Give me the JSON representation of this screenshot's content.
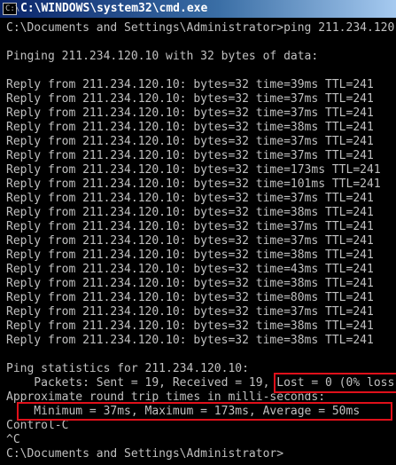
{
  "window": {
    "title": "C:\\WINDOWS\\system32\\cmd.exe",
    "icon_glyph": "C:\\",
    "icon_name": "console-icon",
    "colors": {
      "background": "#000000",
      "text": "#c0c0c0",
      "highlight_box": "#e0101a",
      "titlebar_start": "#0a246a",
      "titlebar_end": "#a6caf0"
    }
  },
  "console": {
    "lines": [
      "C:\\Documents and Settings\\Administrator>ping 211.234.120.10",
      "",
      "Pinging 211.234.120.10 with 32 bytes of data:",
      "",
      "Reply from 211.234.120.10: bytes=32 time=39ms TTL=241",
      "Reply from 211.234.120.10: bytes=32 time=37ms TTL=241",
      "Reply from 211.234.120.10: bytes=32 time=37ms TTL=241",
      "Reply from 211.234.120.10: bytes=32 time=38ms TTL=241",
      "Reply from 211.234.120.10: bytes=32 time=37ms TTL=241",
      "Reply from 211.234.120.10: bytes=32 time=37ms TTL=241",
      "Reply from 211.234.120.10: bytes=32 time=173ms TTL=241",
      "Reply from 211.234.120.10: bytes=32 time=101ms TTL=241",
      "Reply from 211.234.120.10: bytes=32 time=37ms TTL=241",
      "Reply from 211.234.120.10: bytes=32 time=38ms TTL=241",
      "Reply from 211.234.120.10: bytes=32 time=37ms TTL=241",
      "Reply from 211.234.120.10: bytes=32 time=37ms TTL=241",
      "Reply from 211.234.120.10: bytes=32 time=38ms TTL=241",
      "Reply from 211.234.120.10: bytes=32 time=43ms TTL=241",
      "Reply from 211.234.120.10: bytes=32 time=38ms TTL=241",
      "Reply from 211.234.120.10: bytes=32 time=80ms TTL=241",
      "Reply from 211.234.120.10: bytes=32 time=37ms TTL=241",
      "Reply from 211.234.120.10: bytes=32 time=38ms TTL=241",
      "Reply from 211.234.120.10: bytes=32 time=38ms TTL=241",
      "",
      "Ping statistics for 211.234.120.10:",
      "    Packets: Sent = 19, Received = 19, Lost = 0 (0% loss),",
      "Approximate round trip times in milli-seconds:",
      "    Minimum = 37ms, Maximum = 173ms, Average = 50ms",
      "Control-C",
      "^C",
      "C:\\Documents and Settings\\Administrator>"
    ]
  }
}
